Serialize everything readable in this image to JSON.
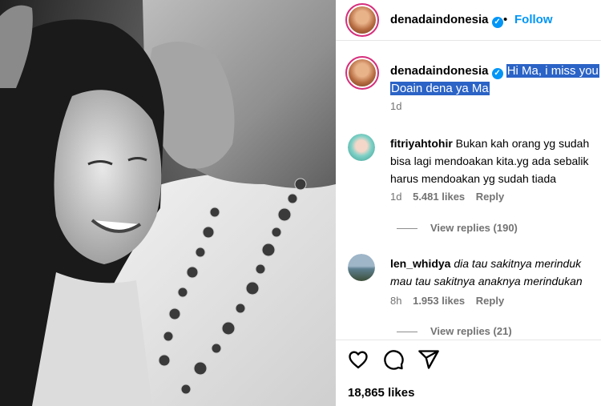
{
  "post": {
    "username": "denadaindonesia",
    "follow_label": "Follow",
    "separator": "•",
    "caption_line1": "Hi Ma, i miss you",
    "caption_line2": "Doain dena ya Ma",
    "caption_time": "1d",
    "likes": "18,865 likes"
  },
  "comments": [
    {
      "username": "fitriyahtohir",
      "text_line1": "Bukan kah orang yg sudah",
      "text_line2": "bisa lagi mendoakan kita.yg ada sebalik",
      "text_line3": "harus mendoakan yg sudah tiada",
      "time": "1d",
      "likes": "5.481 likes",
      "reply_label": "Reply",
      "view_replies": "View replies (190)"
    },
    {
      "username": "len_whidya",
      "text_line1": "dia tau sakitnya merinduk",
      "text_line2": "mau tau sakitnya anaknya merindukan",
      "time": "8h",
      "likes": "1.953 likes",
      "reply_label": "Reply",
      "view_replies": "View replies (21)"
    }
  ],
  "icons": {
    "like": "heart-icon",
    "comment": "comment-icon",
    "share": "share-icon",
    "verified": "verified-badge-icon"
  },
  "colors": {
    "link_blue": "#0095f6",
    "highlight": "#2b63c6",
    "story_ring": "#d62e7c"
  }
}
